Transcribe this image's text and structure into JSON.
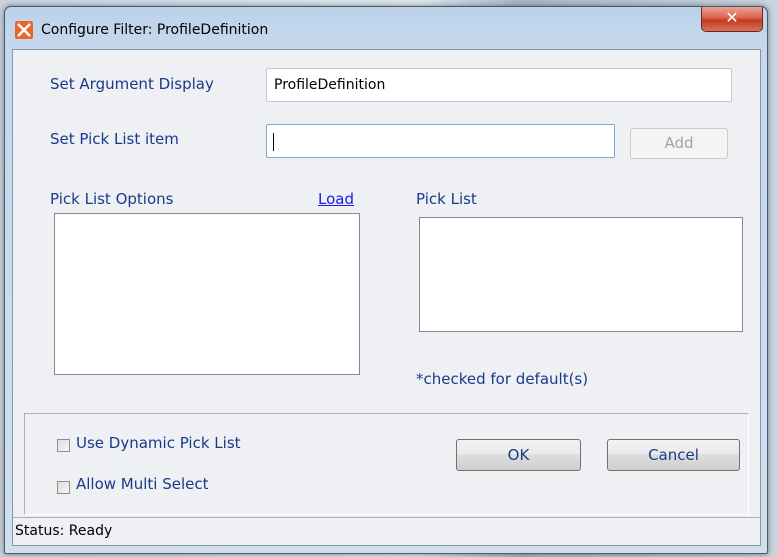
{
  "window": {
    "title": "Configure Filter: ProfileDefinition",
    "close_glyph": "✕"
  },
  "form": {
    "argument_display_label": "Set Argument Display",
    "argument_display_value": "ProfileDefinition",
    "pick_list_item_label": "Set Pick List item",
    "pick_list_item_value": "",
    "add_button": "Add",
    "pick_list_options_label": "Pick List Options",
    "load_link": "Load",
    "pick_list_label": "Pick List",
    "default_note": "*checked for default(s)"
  },
  "options": {
    "dynamic_pick_list_label": "Use Dynamic Pick List",
    "dynamic_pick_list_checked": false,
    "multi_select_label": "Allow Multi Select",
    "multi_select_checked": false
  },
  "buttons": {
    "ok": "OK",
    "cancel": "Cancel"
  },
  "status": {
    "text": "Status: Ready"
  },
  "icons": {
    "app": "app-logo-icon",
    "close": "close-icon"
  },
  "colors": {
    "label_text": "#1a3a8a",
    "link": "#1a1aee",
    "close_button": "#c2391f"
  }
}
